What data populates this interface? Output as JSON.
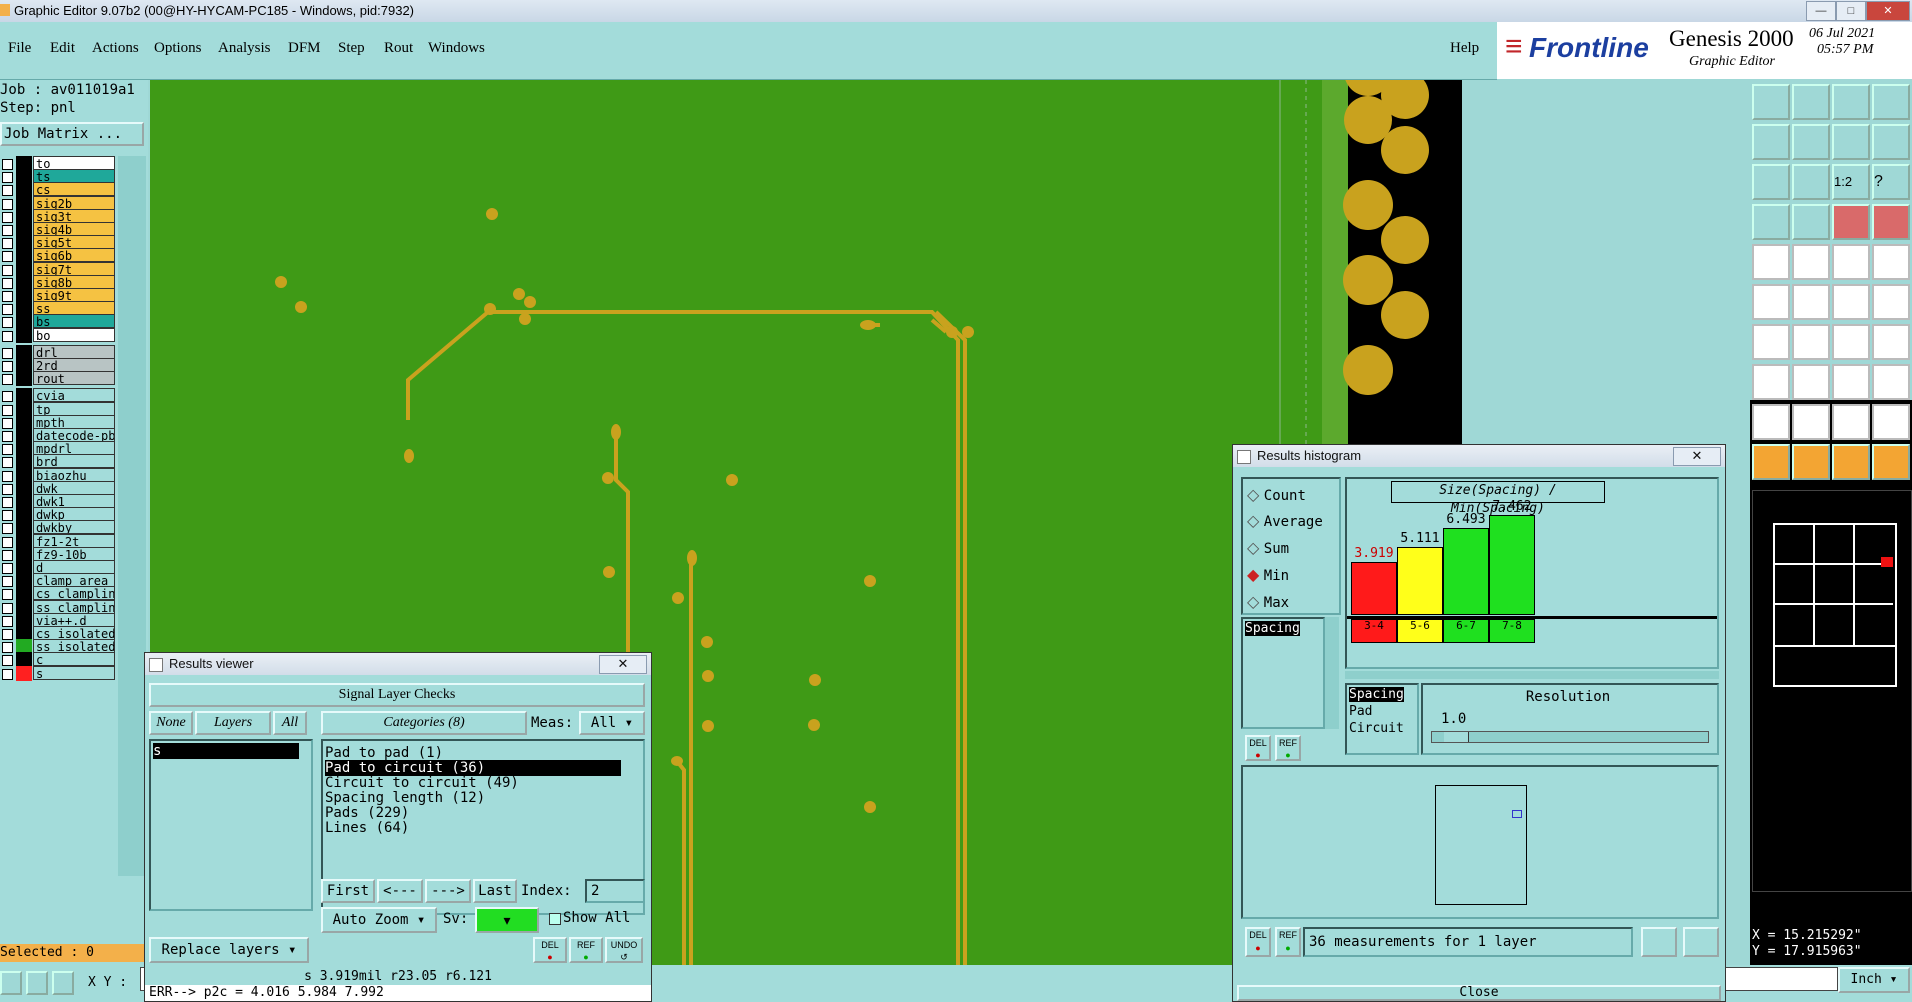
{
  "window": {
    "title": "Graphic Editor 9.07b2 (00@HY-HYCAM-PC185 - Windows, pid:7932)"
  },
  "menu": {
    "items": [
      "File",
      "Edit",
      "Actions",
      "Options",
      "Analysis",
      "DFM",
      "Step",
      "Rout",
      "Windows"
    ],
    "help": "Help"
  },
  "brand": {
    "logo": "Frontline",
    "product": "Genesis 2000",
    "subtitle": "Graphic Editor",
    "date": "06 Jul 2021",
    "time": "05:57 PM"
  },
  "left": {
    "job": "Job : av011019a1",
    "step": "Step: pnl",
    "matrix_button": "Job Matrix ...",
    "layers": [
      {
        "name": "to",
        "color": "#ffffff"
      },
      {
        "name": "ts",
        "color": "#1fa89a"
      },
      {
        "name": "cs",
        "color": "#f5c242"
      },
      {
        "name": "sig2b",
        "color": "#f5c242"
      },
      {
        "name": "sig3t",
        "color": "#f5c242"
      },
      {
        "name": "sig4b",
        "color": "#f5c242"
      },
      {
        "name": "sig5t",
        "color": "#f5c242"
      },
      {
        "name": "sig6b",
        "color": "#f5c242"
      },
      {
        "name": "sig7t",
        "color": "#f5c242"
      },
      {
        "name": "sig8b",
        "color": "#f5c242"
      },
      {
        "name": "sig9t",
        "color": "#f5c242"
      },
      {
        "name": "ss",
        "color": "#f5c242"
      },
      {
        "name": "bs",
        "color": "#1fa89a"
      },
      {
        "name": "bo",
        "color": "#ffffff"
      },
      {
        "name": "drl",
        "color": "#b8c4c4"
      },
      {
        "name": "2rd",
        "color": "#b8c4c4"
      },
      {
        "name": "rout",
        "color": "#b8c4c4"
      },
      {
        "name": "cvia",
        "color": "#a3dcda"
      },
      {
        "name": "tp",
        "color": "#a3dcda"
      },
      {
        "name": "mpth",
        "color": "#a3dcda"
      },
      {
        "name": "datecode-pbe",
        "color": "#a3dcda"
      },
      {
        "name": "mpdrl",
        "color": "#a3dcda"
      },
      {
        "name": "brd",
        "color": "#a3dcda"
      },
      {
        "name": "biaozhu",
        "color": "#a3dcda"
      },
      {
        "name": "dwk",
        "color": "#a3dcda"
      },
      {
        "name": "dwk1",
        "color": "#a3dcda"
      },
      {
        "name": "dwkp",
        "color": "#a3dcda"
      },
      {
        "name": "dwkby",
        "color": "#a3dcda"
      },
      {
        "name": "fz1-2t",
        "color": "#a3dcda"
      },
      {
        "name": "fz9-10b",
        "color": "#a3dcda"
      },
      {
        "name": "d",
        "color": "#a3dcda"
      },
      {
        "name": "clamp_area",
        "color": "#a3dcda"
      },
      {
        "name": "cs_clampline",
        "color": "#a3dcda"
      },
      {
        "name": "ss_clampline",
        "color": "#a3dcda"
      },
      {
        "name": "via++.d",
        "color": "#a3dcda"
      },
      {
        "name": "cs_isolated_",
        "color": "#a3dcda"
      },
      {
        "name": "ss_isolated_",
        "color": "#a3dcda"
      },
      {
        "name": "c",
        "color": "#a3dcda"
      },
      {
        "name": "s",
        "color": "#a3dcda"
      }
    ],
    "selected": "Selected : 0"
  },
  "results_viewer": {
    "title": "Results viewer",
    "header": "Signal Layer Checks",
    "none": "None",
    "layers": "Layers",
    "all": "All",
    "categories": "Categories (8)",
    "meas_label": "Meas:",
    "meas_value": "All",
    "layer_list": [
      "s"
    ],
    "category_list": [
      "Pad to pad (1)",
      "Pad to circuit (36)",
      "Circuit to circuit (49)",
      "Spacing length (12)",
      "Pads (229)",
      "Lines (64)"
    ],
    "nav": {
      "first": "First",
      "prev": "<---",
      "next": "--->",
      "last": "Last",
      "index_label": "Index:",
      "index_value": "2"
    },
    "auto_zoom": "Auto Zoom",
    "sv_label": "Sv:",
    "show_all": "Show All",
    "replace_layers": "Replace layers",
    "del": "DEL",
    "ref": "REF",
    "undo": "UNDO",
    "status": "s 3.919mil  r23.05  r6.121",
    "err": "ERR--> p2c = 4.016 5.984 7.992"
  },
  "histogram": {
    "title": "Results histogram",
    "modes": [
      "Count",
      "Average",
      "Sum",
      "Min",
      "Max"
    ],
    "selected_mode": "Min",
    "measure_list": [
      "Spacing"
    ],
    "chart_title": "Size(Spacing) / Min(Spacing)",
    "sub_list": [
      "Spacing",
      "Pad",
      "Circuit"
    ],
    "resolution_label": "Resolution",
    "resolution_value": "1.0",
    "del": "DEL",
    "ref": "REF",
    "footer": "36 measurements for 1 layer",
    "close": "Close"
  },
  "chart_data": {
    "type": "bar",
    "title": "Size(Spacing) / Min(Spacing)",
    "categories": [
      "3-4",
      "5-6",
      "6-7",
      "7-8"
    ],
    "values": [
      3.919,
      5.111,
      6.493,
      7.462
    ],
    "colors": [
      "#ff1a1a",
      "#ffff1a",
      "#1fe01f",
      "#1fe01f"
    ],
    "value_labels": [
      "3.919",
      "5.111",
      "6.493",
      "7.462"
    ]
  },
  "status": {
    "xy_label": "X Y :",
    "x": "X = 15.215292\"",
    "y": "Y = 17.915963\"",
    "units": "Inch"
  }
}
